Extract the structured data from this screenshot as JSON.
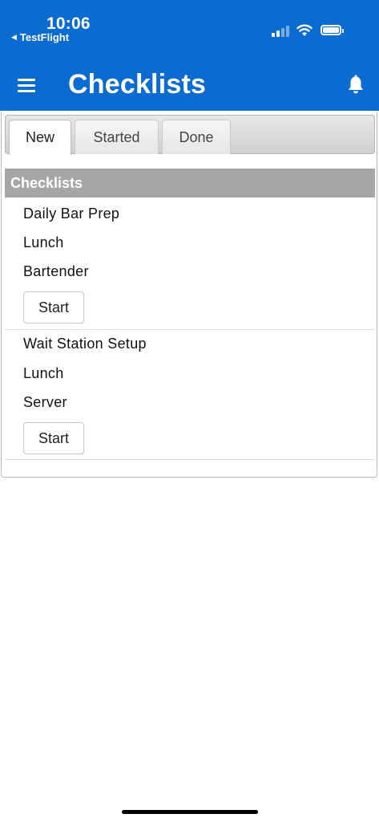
{
  "status_bar": {
    "time": "10:06",
    "back_app": "TestFlight"
  },
  "header": {
    "title": "Checklists",
    "background_color": "#0a6bd0"
  },
  "tabs": [
    {
      "label": "New",
      "active": true
    },
    {
      "label": "Started",
      "active": false
    },
    {
      "label": "Done",
      "active": false
    }
  ],
  "section": {
    "title": "Checklists"
  },
  "checklists": [
    {
      "name": "Daily Bar Prep",
      "shift": "Lunch",
      "role": "Bartender",
      "action": "Start"
    },
    {
      "name": "Wait Station Setup",
      "shift": "Lunch",
      "role": "Server",
      "action": "Start"
    }
  ],
  "icons": {
    "menu": "hamburger-menu-icon",
    "notifications": "bell-icon"
  }
}
